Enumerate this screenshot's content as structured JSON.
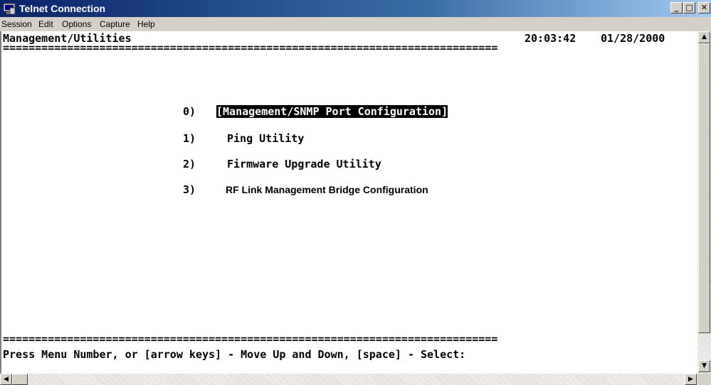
{
  "window": {
    "title": "Telnet Connection",
    "icon": "telnet-app-icon",
    "controls": {
      "minimize": "_",
      "maximize": "□",
      "close": "✕"
    }
  },
  "menubar": [
    "Session",
    "Edit",
    "Options",
    "Capture",
    "Help"
  ],
  "terminal": {
    "header_title": "Management/Utilities",
    "time": "20:03:42",
    "date": "01/28/2000",
    "separator": "=============================================================================",
    "menu": [
      {
        "num": "0)",
        "label": "[Management/SNMP Port Configuration]",
        "selected": true
      },
      {
        "num": "1)",
        "label": "Ping Utility",
        "selected": false
      },
      {
        "num": "2)",
        "label": "Firmware Upgrade Utility",
        "selected": false
      },
      {
        "num": "3)",
        "label": "RF Link Management Bridge Configuration",
        "selected": false
      }
    ],
    "prompt": "Press Menu Number, or [arrow keys] - Move Up and Down, [space] - Select:"
  },
  "scrollbars": {
    "up": "▲",
    "down": "▼",
    "left": "◀",
    "right": "▶"
  },
  "colors": {
    "titlebar_start": "#0a246a",
    "titlebar_end": "#a6caf0",
    "chrome": "#d4d0c8",
    "terminal_bg": "#ffffff",
    "terminal_fg": "#000000",
    "highlight_bg": "#000000",
    "highlight_fg": "#ffffff"
  }
}
